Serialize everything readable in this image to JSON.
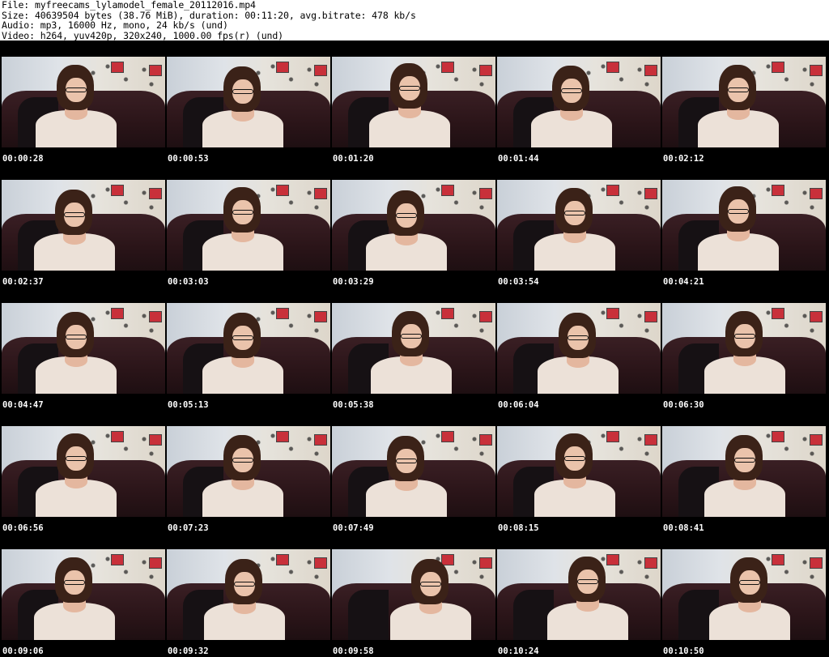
{
  "header": {
    "file_line": "File: myfreecams_lylamodel_female_20112016.mp4",
    "size_line": "Size: 40639504 bytes (38.76 MiB), duration: 00:11:20, avg.bitrate: 478 kb/s",
    "audio_line": "Audio: mp3, 16000 Hz, mono, 24 kb/s (und)",
    "video_line": "Video: h264, yuv420p, 320x240, 1000.00 fps(r) (und)"
  },
  "colors": {
    "background": "#ffffff",
    "grid_background": "#000000",
    "timestamp_text": "#ffffff"
  },
  "thumbnails": [
    {
      "timestamp": "00:00:28"
    },
    {
      "timestamp": "00:00:53"
    },
    {
      "timestamp": "00:01:20"
    },
    {
      "timestamp": "00:01:44"
    },
    {
      "timestamp": "00:02:12"
    },
    {
      "timestamp": "00:02:37"
    },
    {
      "timestamp": "00:03:03"
    },
    {
      "timestamp": "00:03:29"
    },
    {
      "timestamp": "00:03:54"
    },
    {
      "timestamp": "00:04:21"
    },
    {
      "timestamp": "00:04:47"
    },
    {
      "timestamp": "00:05:13"
    },
    {
      "timestamp": "00:05:38"
    },
    {
      "timestamp": "00:06:04"
    },
    {
      "timestamp": "00:06:30"
    },
    {
      "timestamp": "00:06:56"
    },
    {
      "timestamp": "00:07:23"
    },
    {
      "timestamp": "00:07:49"
    },
    {
      "timestamp": "00:08:15"
    },
    {
      "timestamp": "00:08:41"
    },
    {
      "timestamp": "00:09:06"
    },
    {
      "timestamp": "00:09:32"
    },
    {
      "timestamp": "00:09:58"
    },
    {
      "timestamp": "00:10:24"
    },
    {
      "timestamp": "00:10:50"
    }
  ]
}
